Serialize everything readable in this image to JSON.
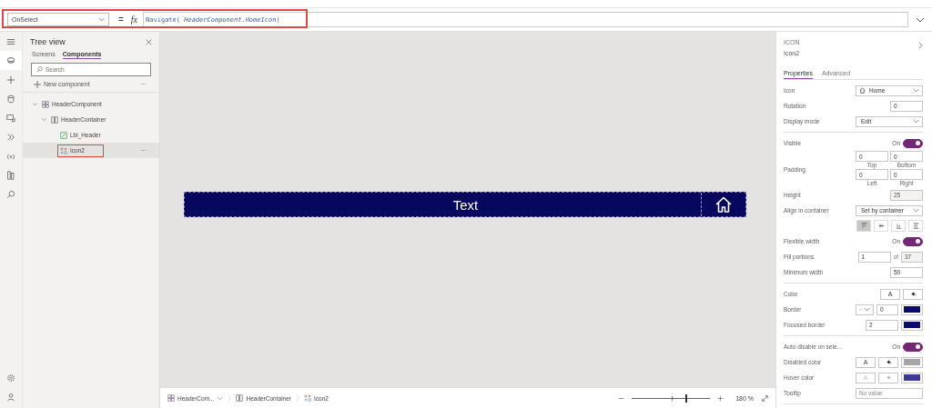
{
  "formula_bar": {
    "property": "OnSelect",
    "equals": "=",
    "fx": "fx",
    "formula": "Navigate( *HeaderComponent.HomeIcon*)",
    "highlighted": true
  },
  "rail": {
    "items": [
      {
        "kind": "menu",
        "selected": false
      },
      {
        "kind": "tree",
        "selected": true
      },
      {
        "kind": "plus",
        "selected": false
      },
      {
        "kind": "data",
        "selected": false
      },
      {
        "kind": "media",
        "selected": false
      },
      {
        "kind": "flow",
        "selected": false
      },
      {
        "kind": "variables",
        "text": "(x)",
        "selected": false
      },
      {
        "kind": "library",
        "selected": false
      },
      {
        "kind": "search",
        "selected": false
      }
    ],
    "bottom": [
      {
        "kind": "settings",
        "selected": false
      },
      {
        "kind": "person",
        "selected": false
      }
    ]
  },
  "tree_view": {
    "title": "Tree view",
    "tabs": [
      {
        "label": "Screens",
        "selected": false
      },
      {
        "label": "Components",
        "selected": true
      }
    ],
    "search": {
      "placeholder": "Search"
    },
    "new_component": "New component",
    "more": "···",
    "items": [
      {
        "label": "HeaderComponent",
        "kind": "component",
        "expanded": true,
        "selected": false,
        "highlighted": false,
        "children": [
          {
            "label": "HeaderContainer",
            "kind": "container",
            "expanded": true,
            "selected": false,
            "highlighted": false,
            "children": [
              {
                "label": "Lbl_Header",
                "kind": "label",
                "selected": false,
                "highlighted": false
              },
              {
                "label": "Icon2",
                "kind": "icon",
                "selected": true,
                "highlighted": true,
                "more": "···"
              }
            ]
          }
        ]
      }
    ]
  },
  "canvas": {
    "header_text": "Text"
  },
  "properties": {
    "type": "ICON",
    "name": "Icon2",
    "tabs": [
      {
        "label": "Properties",
        "selected": true
      },
      {
        "label": "Advanced",
        "selected": false
      }
    ],
    "sections": [
      [
        {
          "kind": "icon_dropdown",
          "label": "Icon",
          "value": "Home"
        },
        {
          "kind": "number",
          "label": "Rotation",
          "value": "0",
          "disabled": false
        },
        {
          "kind": "dropdown",
          "label": "Display mode",
          "value": "Edit"
        }
      ],
      [
        {
          "kind": "toggle",
          "label": "Visible",
          "text": "On",
          "on": true
        },
        {
          "kind": "padding",
          "label": "Padding",
          "fields": [
            {
              "value": "0",
              "caption": "Top"
            },
            {
              "value": "0",
              "caption": "Bottom"
            },
            {
              "value": "0",
              "caption": "Left"
            },
            {
              "value": "0",
              "caption": "Right"
            }
          ]
        },
        {
          "kind": "number",
          "label": "Height",
          "value": "25",
          "disabled": true
        },
        {
          "kind": "dropdown",
          "label": "Align in container",
          "value": "Set by container"
        },
        {
          "kind": "align",
          "buttons": [
            {
              "selected": true
            },
            {
              "selected": false
            },
            {
              "selected": false
            },
            {
              "selected": false
            }
          ]
        },
        {
          "kind": "toggle",
          "label": "Flexible width",
          "text": "On",
          "on": true
        },
        {
          "kind": "portions",
          "label": "Fill portions",
          "value": "1",
          "of": "of",
          "total": "37"
        },
        {
          "kind": "number",
          "label": "Minimum width",
          "value": "50",
          "disabled": false
        }
      ],
      [
        {
          "kind": "color",
          "label": "Color",
          "letter": "A",
          "faded": false
        },
        {
          "kind": "border",
          "label": "Border",
          "value": "0",
          "color": "#0b0b6b"
        },
        {
          "kind": "focused",
          "label": "Focused border",
          "value": "2",
          "color": "#0b0b6b"
        }
      ],
      [
        {
          "kind": "toggle",
          "label": "Auto disable on sele...",
          "text": "On",
          "on": true
        },
        {
          "kind": "color",
          "label": "Disabled color",
          "letter": "A",
          "faded": false,
          "color": "#a6a6a6"
        },
        {
          "kind": "color",
          "label": "Hover color",
          "letter": "A",
          "faded": true,
          "color": "#3b3b94"
        },
        {
          "kind": "text",
          "label": "Tooltip",
          "placeholder": "No value"
        }
      ]
    ]
  },
  "status_bar": {
    "breadcrumbs": [
      {
        "label": "HeaderCom...",
        "kind": "component",
        "dropdown": true
      },
      {
        "label": "HeaderContainer",
        "kind": "container",
        "dropdown": false
      },
      {
        "label": "Icon2",
        "kind": "icon",
        "dropdown": false
      }
    ],
    "zoom": {
      "level": 0.7,
      "reading": "180 %"
    }
  }
}
